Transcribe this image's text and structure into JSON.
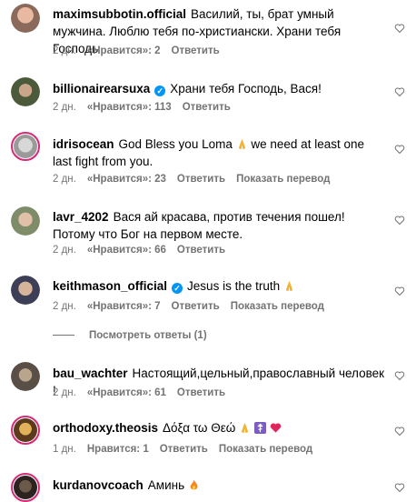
{
  "comments": [
    {
      "user": "maximsubbotin.official",
      "text": "Василий, ты, брат умный мужчина. Люблю тебя по-христиански. Храни тебя Господь",
      "time": "2 дн.",
      "likes": "«Нравится»: 2",
      "reply": "Ответить"
    },
    {
      "user": "billionairearsuxa",
      "verified": "✓",
      "text": "Храни тебя Господь, Вася!",
      "time": "2 дн.",
      "likes": "«Нравится»: 113",
      "reply": "Ответить"
    },
    {
      "user": "idrisocean",
      "text": "God Bless you Loma",
      "text2": "we need at least one last fight from you.",
      "time": "2 дн.",
      "likes": "«Нравится»: 23",
      "reply": "Ответить",
      "translate": "Показать перевод"
    },
    {
      "user": "lavr_4202",
      "text": "Вася ай красава, против течения пошел! Потому что Бог на первом месте.",
      "time": "2 дн.",
      "likes": "«Нравится»: 66",
      "reply": "Ответить"
    },
    {
      "user": "keithmason_official",
      "verified": "✓",
      "text": "Jesus is the truth",
      "time": "2 дн.",
      "likes": "«Нравится»: 7",
      "reply": "Ответить",
      "translate": "Показать перевод"
    },
    {
      "user": "bau_wachter",
      "text": "Настоящий,цельный,православный человек !",
      "time": "2 дн.",
      "likes": "«Нравится»: 61",
      "reply": "Ответить"
    },
    {
      "user": "orthodoxy.theosis",
      "text": "Δόξα τω Θεώ",
      "time": "1 дн.",
      "likes": "Нравится: 1",
      "reply": "Ответить",
      "translate": "Показать перевод"
    },
    {
      "user": "kurdanovcoach",
      "text": "Аминь"
    }
  ],
  "view_replies": "Посмотреть ответы (1)",
  "icons": {
    "like": "heart-icon",
    "pray": "praying-hands-emoji",
    "cross": "orthodox-cross-emoji",
    "heart": "red-heart-emoji",
    "fire": "fire-emoji"
  },
  "colors": {
    "meta": "#737373",
    "verified": "#0095f6",
    "story_ring": "#d62976",
    "heart_emoji": "#e0245e"
  }
}
